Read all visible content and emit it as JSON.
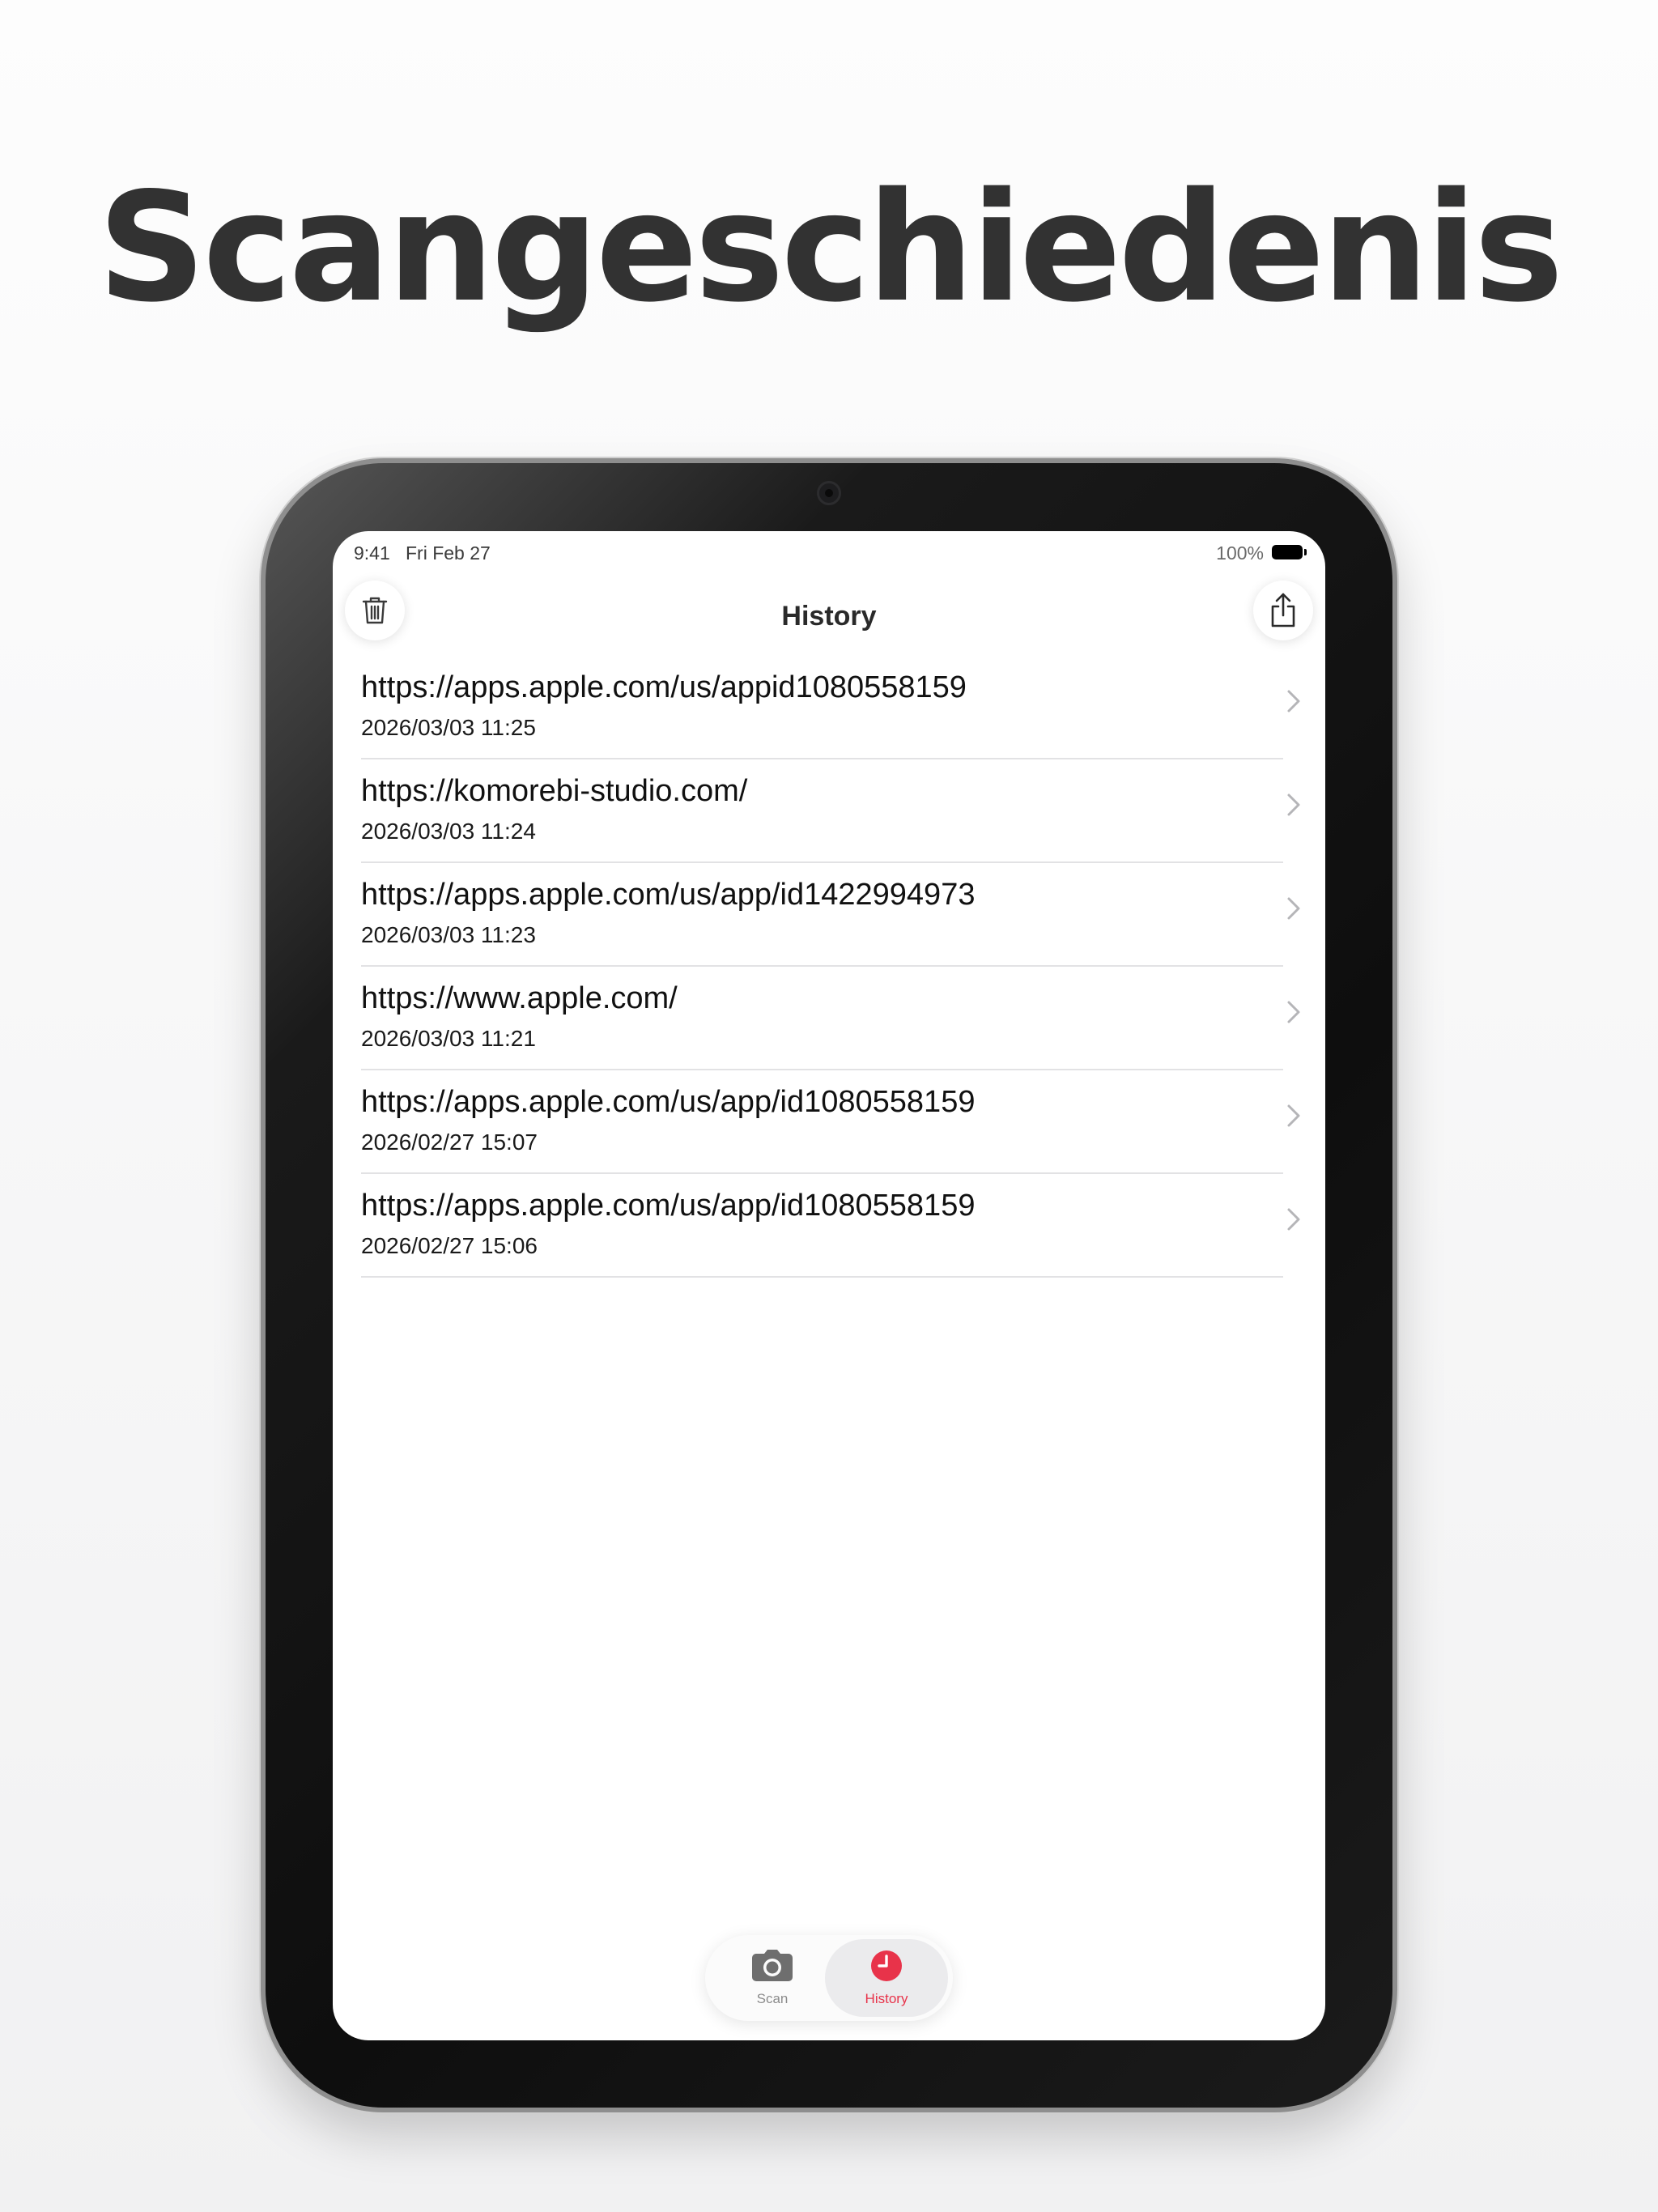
{
  "headline": "Scangeschiedenis",
  "status_bar": {
    "time": "9:41",
    "date": "Fri Feb 27",
    "battery": "100%"
  },
  "nav": {
    "title": "History"
  },
  "history": [
    {
      "url": "https://apps.apple.com/us/appid1080558159",
      "date": "2026/03/03 11:25"
    },
    {
      "url": "https://komorebi-studio.com/",
      "date": "2026/03/03 11:24"
    },
    {
      "url": "https://apps.apple.com/us/app/id1422994973",
      "date": "2026/03/03 11:23"
    },
    {
      "url": "https://www.apple.com/",
      "date": "2026/03/03 11:21"
    },
    {
      "url": "https://apps.apple.com/us/app/id1080558159",
      "date": "2026/02/27 15:07"
    },
    {
      "url": "https://apps.apple.com/us/app/id1080558159",
      "date": "2026/02/27 15:06"
    }
  ],
  "tabs": [
    {
      "label": "Scan",
      "icon": "camera-icon"
    },
    {
      "label": "History",
      "icon": "clock-icon",
      "selected": true
    }
  ],
  "colors": {
    "accent": "#e8334a",
    "headline": "#323232"
  }
}
